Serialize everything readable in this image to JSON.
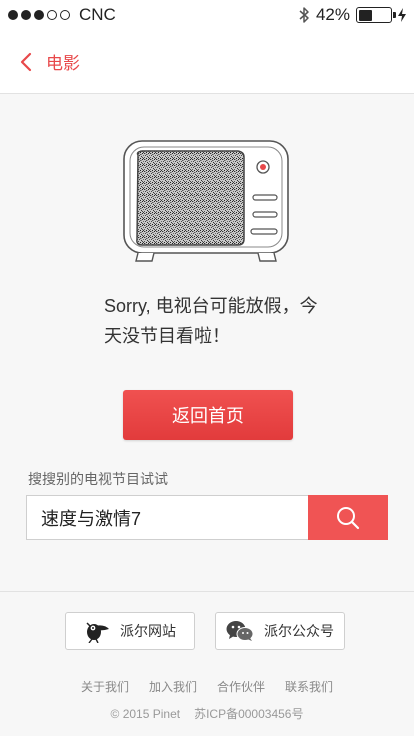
{
  "status_bar": {
    "carrier": "CNC",
    "battery": "42%",
    "signal_bars_filled": 3,
    "signal_bars_total": 5,
    "battery_level": 0.42,
    "bluetooth_icon": "bluetooth-icon",
    "charging_icon": "charging-icon"
  },
  "nav": {
    "back_icon": "chevron-left-icon",
    "title": "电影"
  },
  "main": {
    "tv_icon": "tv-static-icon",
    "message_line1": "Sorry, 电视台可能放假，今",
    "message_line2": "天没节目看啦！",
    "home_button": "返回首页",
    "search_label": "搜搜别的电视节目试试",
    "search_value": "速度与激情7",
    "search_icon": "search-icon"
  },
  "footer": {
    "site_button": "派尔网站",
    "wechat_button": "派尔公众号",
    "links": [
      "关于我们",
      "加入我们",
      "合作伙伴",
      "联系我们"
    ],
    "copyright": "© 2015 Pinet",
    "icp": "苏ICP备00003456号"
  },
  "colors": {
    "accent": "#e8484a",
    "button_red": "#f05454",
    "background": "#f7f7f7"
  }
}
